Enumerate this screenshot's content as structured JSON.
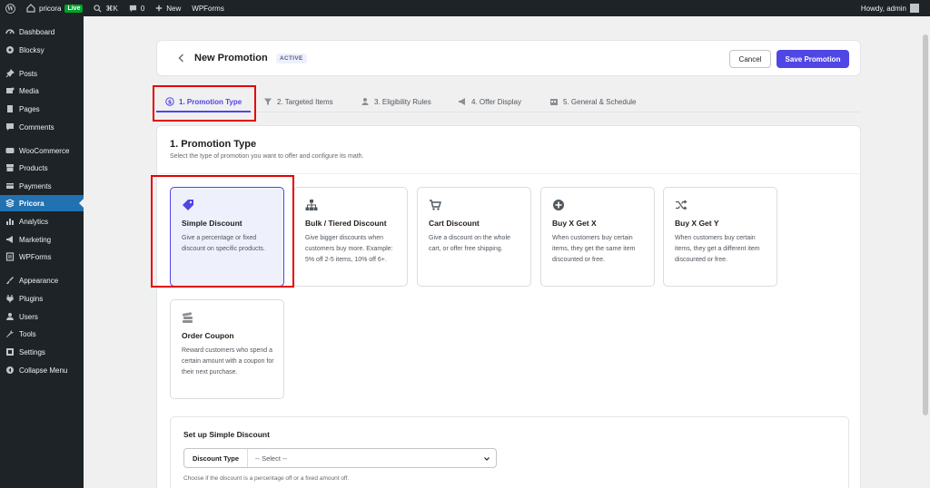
{
  "adminbar": {
    "site_name": "pricora",
    "live_badge": "Live",
    "shortcut": "⌘K",
    "comments_count": "0",
    "new_label": "New",
    "wpforms_label": "WPForms",
    "howdy": "Howdy, admin"
  },
  "sidebar": {
    "items": [
      {
        "label": "Dashboard",
        "icon": "dashboard-icon"
      },
      {
        "label": "Blocksy",
        "icon": "blocksy-icon"
      },
      {
        "label": "Posts",
        "icon": "pin-icon"
      },
      {
        "label": "Media",
        "icon": "media-icon"
      },
      {
        "label": "Pages",
        "icon": "page-icon"
      },
      {
        "label": "Comments",
        "icon": "comment-icon"
      },
      {
        "label": "WooCommerce",
        "icon": "woo-icon"
      },
      {
        "label": "Products",
        "icon": "archive-icon"
      },
      {
        "label": "Payments",
        "icon": "card-icon"
      },
      {
        "label": "Pricora",
        "icon": "pricora-icon"
      },
      {
        "label": "Analytics",
        "icon": "bar-chart-icon"
      },
      {
        "label": "Marketing",
        "icon": "megaphone-icon"
      },
      {
        "label": "WPForms",
        "icon": "form-icon"
      },
      {
        "label": "Appearance",
        "icon": "brush-icon"
      },
      {
        "label": "Plugins",
        "icon": "plug-icon"
      },
      {
        "label": "Users",
        "icon": "user-icon"
      },
      {
        "label": "Tools",
        "icon": "wrench-icon"
      },
      {
        "label": "Settings",
        "icon": "settings-icon"
      },
      {
        "label": "Collapse Menu",
        "icon": "collapse-icon"
      }
    ]
  },
  "header": {
    "title": "New Promotion",
    "status": "ACTIVE",
    "cancel_label": "Cancel",
    "save_label": "Save Promotion"
  },
  "tabs": [
    {
      "label": "1. Promotion Type",
      "icon": "dollar-circle-icon"
    },
    {
      "label": "2. Targeted Items",
      "icon": "funnel-icon"
    },
    {
      "label": "3. Eligibility Rules",
      "icon": "person-icon"
    },
    {
      "label": "4. Offer Display",
      "icon": "megaphone-icon"
    },
    {
      "label": "5. General & Schedule",
      "icon": "calendar-icon"
    }
  ],
  "section": {
    "title": "1. Promotion Type",
    "subtitle": "Select the type of promotion you want to offer and configure its math."
  },
  "promotion_types": [
    {
      "title": "Simple Discount",
      "desc": "Give a percentage or fixed discount on specific products.",
      "icon": "tag-icon",
      "selected": true
    },
    {
      "title": "Bulk / Tiered Discount",
      "desc": "Give bigger discounts when customers buy more. Example: 5% off 2-5 items, 10% off 6+.",
      "icon": "hierarchy-icon"
    },
    {
      "title": "Cart Discount",
      "desc": "Give a discount on the whole cart, or offer free shipping.",
      "icon": "cart-icon"
    },
    {
      "title": "Buy X Get X",
      "desc": "When customers buy certain items, they get the same item discounted or free.",
      "icon": "plus-circle-icon"
    },
    {
      "title": "Buy X Get Y",
      "desc": "When customers buy certain items, they get a different item discounted or free.",
      "icon": "shuffle-icon"
    },
    {
      "title": "Order Coupon",
      "desc": "Reward customers who spend a certain amount with a coupon for their next purchase.",
      "icon": "coupon-stack-icon"
    }
  ],
  "setup": {
    "title": "Set up Simple Discount",
    "discount_type_label": "Discount Type",
    "discount_type_value": "-- Select --",
    "help": "Choose if the discount is a percentage off or a fixed amount off."
  },
  "colors": {
    "accent": "#4f46e5",
    "annotation": "#e60000",
    "wp_dark": "#1d2327",
    "wp_blue": "#2271b1"
  }
}
